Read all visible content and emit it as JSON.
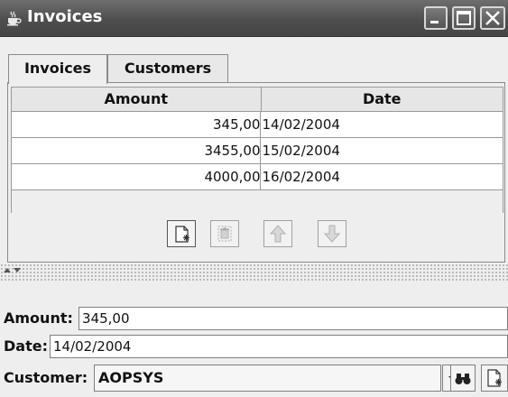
{
  "window": {
    "title": "Invoices",
    "icons": {
      "app": "java-cup-icon",
      "minimize": "minimize-icon",
      "maximize": "maximize-icon",
      "close": "close-icon"
    }
  },
  "tabs": [
    {
      "label": "Invoices",
      "selected": true
    },
    {
      "label": "Customers",
      "selected": false
    }
  ],
  "table": {
    "columns": [
      "Amount",
      "Date"
    ],
    "rows": [
      {
        "amount": "345,00",
        "date": "14/02/2004"
      },
      {
        "amount": "3455,00",
        "date": "15/02/2004"
      },
      {
        "amount": "4000,00",
        "date": "16/02/2004"
      }
    ]
  },
  "toolbar": [
    {
      "icon": "new-document-icon",
      "enabled": true
    },
    {
      "icon": "delete-icon",
      "enabled": false
    },
    {
      "icon": "move-up-icon",
      "enabled": false
    },
    {
      "icon": "move-down-icon",
      "enabled": false
    }
  ],
  "form": {
    "amount_label": "Amount:",
    "amount_value": "345,00",
    "date_label": "Date:",
    "date_value": "14/02/2004",
    "customer_label": "Customer:",
    "customer_value": "AOPSYS",
    "customer_buttons": [
      "dropdown-arrow-icon",
      "binoculars-search-icon",
      "new-document-icon"
    ]
  }
}
